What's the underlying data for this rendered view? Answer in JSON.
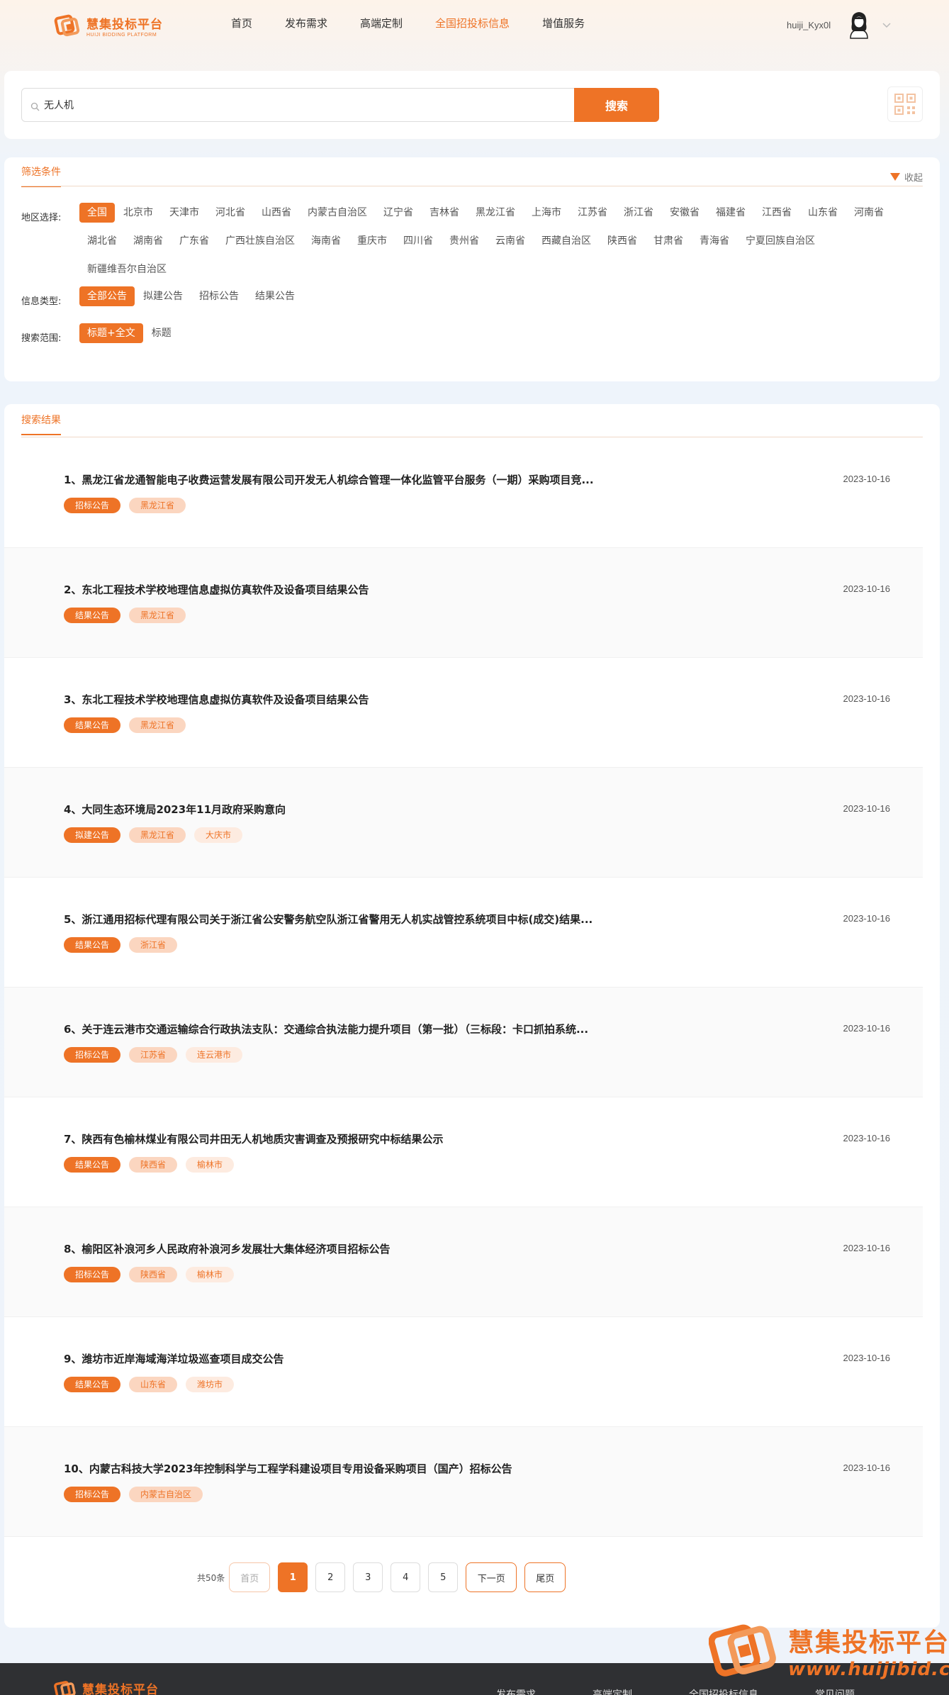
{
  "header": {
    "logo_title": "慧集投标平台",
    "logo_sub": "HUIJI BIDDING PLATFORM",
    "nav": [
      {
        "label": "首页",
        "active": false
      },
      {
        "label": "发布需求",
        "active": false
      },
      {
        "label": "高端定制",
        "active": false
      },
      {
        "label": "全国招投标信息",
        "active": true
      },
      {
        "label": "增值服务",
        "active": false
      }
    ],
    "user_name": "huiji_Kyx0l"
  },
  "search": {
    "value": "无人机",
    "button_label": "搜索"
  },
  "filter": {
    "tab_label": "筛选条件",
    "collapse_label": "收起",
    "region_label": "地区选择:",
    "regions": [
      "全国",
      "北京市",
      "天津市",
      "河北省",
      "山西省",
      "内蒙古自治区",
      "辽宁省",
      "吉林省",
      "黑龙江省",
      "上海市",
      "江苏省",
      "浙江省",
      "安徽省",
      "福建省",
      "江西省",
      "山东省",
      "河南省",
      "湖北省",
      "湖南省",
      "广东省",
      "广西壮族自治区",
      "海南省",
      "重庆市",
      "四川省",
      "贵州省",
      "云南省",
      "西藏自治区",
      "陕西省",
      "甘肃省",
      "青海省",
      "宁夏回族自治区",
      "新疆维吾尔自治区"
    ],
    "type_label": "信息类型:",
    "types": [
      "全部公告",
      "拟建公告",
      "招标公告",
      "结果公告"
    ],
    "scope_label": "搜索范围:",
    "scopes": [
      "标题+全文",
      "标题"
    ]
  },
  "results": {
    "tab_label": "搜索结果",
    "items": [
      {
        "title": "1、黑龙江省龙通智能电子收费运营发展有限公司开发无人机综合管理一体化监管平台服务（一期）采购项目竞...",
        "date": "2023-10-16",
        "type": "招标公告",
        "province": "黑龙江省",
        "city": ""
      },
      {
        "title": "2、东北工程技术学校地理信息虚拟仿真软件及设备项目结果公告",
        "date": "2023-10-16",
        "type": "结果公告",
        "province": "黑龙江省",
        "city": ""
      },
      {
        "title": "3、东北工程技术学校地理信息虚拟仿真软件及设备项目结果公告",
        "date": "2023-10-16",
        "type": "结果公告",
        "province": "黑龙江省",
        "city": ""
      },
      {
        "title": "4、大同生态环境局2023年11月政府采购意向",
        "date": "2023-10-16",
        "type": "拟建公告",
        "province": "黑龙江省",
        "city": "大庆市"
      },
      {
        "title": "5、浙江通用招标代理有限公司关于浙江省公安警务航空队浙江省警用无人机实战管控系统项目中标(成交)结果...",
        "date": "2023-10-16",
        "type": "结果公告",
        "province": "浙江省",
        "city": ""
      },
      {
        "title": "6、关于连云港市交通运输综合行政执法支队：交通综合执法能力提升项目（第一批）（三标段：卡口抓拍系统...",
        "date": "2023-10-16",
        "type": "招标公告",
        "province": "江苏省",
        "city": "连云港市"
      },
      {
        "title": "7、陕西有色榆林煤业有限公司井田无人机地质灾害调查及预报研究中标结果公示",
        "date": "2023-10-16",
        "type": "结果公告",
        "province": "陕西省",
        "city": "榆林市"
      },
      {
        "title": "8、榆阳区补浪河乡人民政府补浪河乡发展壮大集体经济项目招标公告",
        "date": "2023-10-16",
        "type": "招标公告",
        "province": "陕西省",
        "city": "榆林市"
      },
      {
        "title": "9、潍坊市近岸海域海洋垃圾巡查项目成交公告",
        "date": "2023-10-16",
        "type": "结果公告",
        "province": "山东省",
        "city": "潍坊市"
      },
      {
        "title": "10、内蒙古科技大学2023年控制科学与工程学科建设项目专用设备采购项目（国产）招标公告",
        "date": "2023-10-16",
        "type": "招标公告",
        "province": "内蒙古自治区",
        "city": ""
      }
    ]
  },
  "pager": {
    "total": "共50条",
    "first": "首页",
    "pages": [
      "1",
      "2",
      "3",
      "4",
      "5"
    ],
    "current": "1",
    "next": "下一页",
    "last": "尾页"
  },
  "watermark": {
    "title": "慧集投标平台",
    "url": "www.huijibid.cn"
  },
  "footer": {
    "logo_title": "慧集投标平台",
    "links": [
      "发布需求",
      "高端定制",
      "全国招投标信息",
      "常见问题"
    ]
  },
  "colors": {
    "accent": "#ee7326",
    "tag_province_bg": "#fbd6c0",
    "tag_city_bg": "#fdebe0",
    "footer_bg": "#2f3033"
  }
}
